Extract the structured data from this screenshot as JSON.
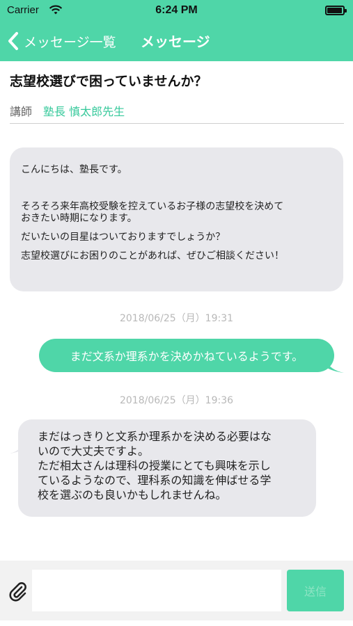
{
  "status_bar": {
    "carrier": "Carrier",
    "time": "6:24 PM"
  },
  "nav": {
    "back_label": "メッセージ一覧",
    "title": "メッセージ"
  },
  "thread": {
    "subject": "志望校選びで困っていませんか？",
    "teacher_label": "講師",
    "teacher_name": "塾長 慎太郎先生"
  },
  "messages": [
    {
      "from": "teacher",
      "lines": [
        "こんにちは、塾長です。",
        "そろそろ来年高校受験を控えているお子様の志望校を決めて",
        "おきたい時期になります。",
        "だいたいの目星はついておりますでしょうか？",
        "志望校選びにお困りのことがあれば、ぜひご相談ください！"
      ]
    },
    {
      "timestamp": "2018/06/25（月）19:31"
    },
    {
      "from": "me",
      "text": "まだ文系か理系かを決めかねているようです。"
    },
    {
      "timestamp": "2018/06/25（月）19:36"
    },
    {
      "from": "teacher",
      "lines": [
        "まだはっきりと文系か理系かを決める必要はな",
        "いので大丈夫ですよ。",
        "ただ相太さんは理科の授業にとても興味を示し",
        "ているようなので、理科系の知識を伸ばせる学",
        "校を選ぶのも良いかもしれませんね。"
      ]
    }
  ],
  "composer": {
    "input_value": "",
    "send_label": "送信"
  },
  "colors": {
    "accent": "#4fd6a8",
    "bubble_gray": "#e8e8ec",
    "timestamp": "#b8b8b8"
  },
  "icons": {
    "back": "chevron-left-icon",
    "attach": "paperclip-icon",
    "wifi": "wifi-icon",
    "battery": "battery-icon"
  }
}
